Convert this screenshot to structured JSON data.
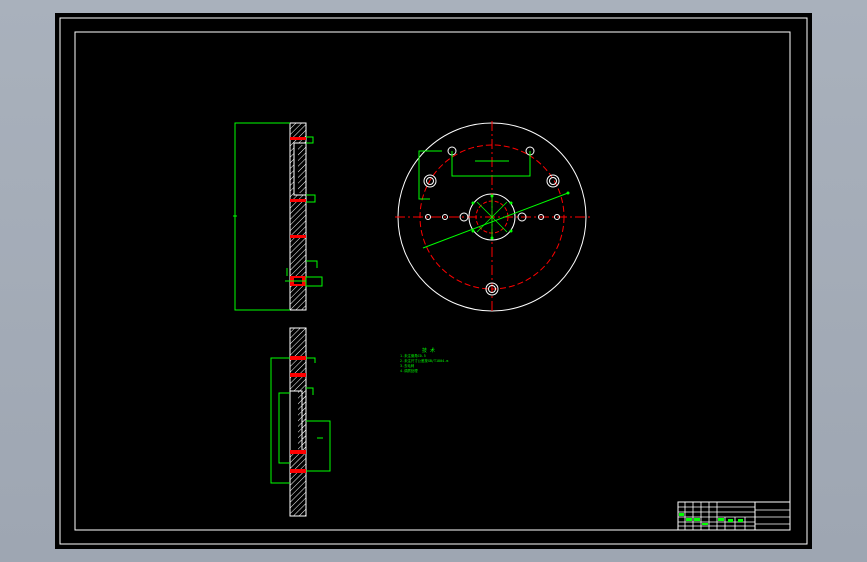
{
  "viewport": {
    "background": "#000000",
    "frame_color": "#ffffff",
    "outline_color": "#00ff00",
    "centerline_color": "#ff0000",
    "hatch_color": "#ffffff"
  },
  "technical_notes": {
    "heading": "技 术",
    "lines": [
      "1.未注倒角C0.5",
      "2.未注尺寸公差按GB/T1804-m",
      "3.去毛刺",
      "4.调质处理"
    ]
  },
  "title_block": {
    "rows": 6,
    "label": ""
  }
}
